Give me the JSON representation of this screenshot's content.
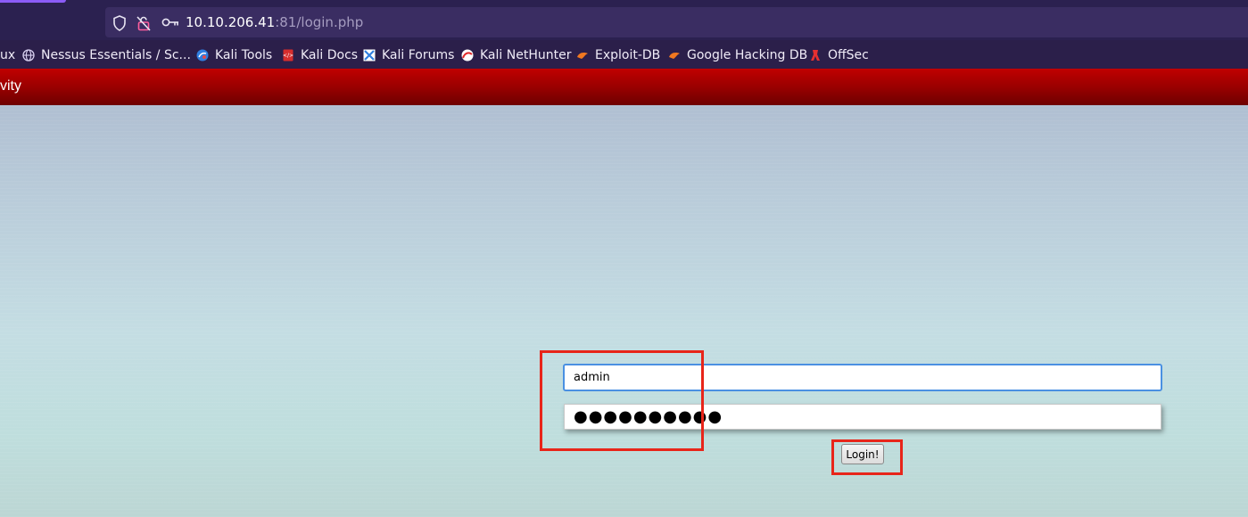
{
  "browser": {
    "url_host": "10.10.206.41",
    "url_rest": ":81/login.php",
    "icons": [
      "shield-icon",
      "lock-slash-icon",
      "key-icon"
    ]
  },
  "bookmarks": [
    {
      "label": "ux",
      "icon": "none"
    },
    {
      "label": "Nessus Essentials / Sc...",
      "icon": "globe-icon"
    },
    {
      "label": "Kali Tools",
      "icon": "kali-tools-icon"
    },
    {
      "label": "Kali Docs",
      "icon": "kali-docs-icon"
    },
    {
      "label": "Kali Forums",
      "icon": "kali-forums-icon"
    },
    {
      "label": "Kali NetHunter",
      "icon": "kali-nethunter-icon"
    },
    {
      "label": "Exploit-DB",
      "icon": "exploit-db-icon"
    },
    {
      "label": "Google Hacking DB",
      "icon": "ghdb-icon"
    },
    {
      "label": "OffSec",
      "icon": "offsec-icon"
    }
  ],
  "site": {
    "nav_text": "vity"
  },
  "form": {
    "username_value": "admin",
    "password_value": "●●●●●●●●●●",
    "login_label": "Login!"
  },
  "colors": {
    "nav_red": "#9a0000",
    "annotation_red": "#e8251a",
    "focus_blue": "#4a90e2"
  }
}
